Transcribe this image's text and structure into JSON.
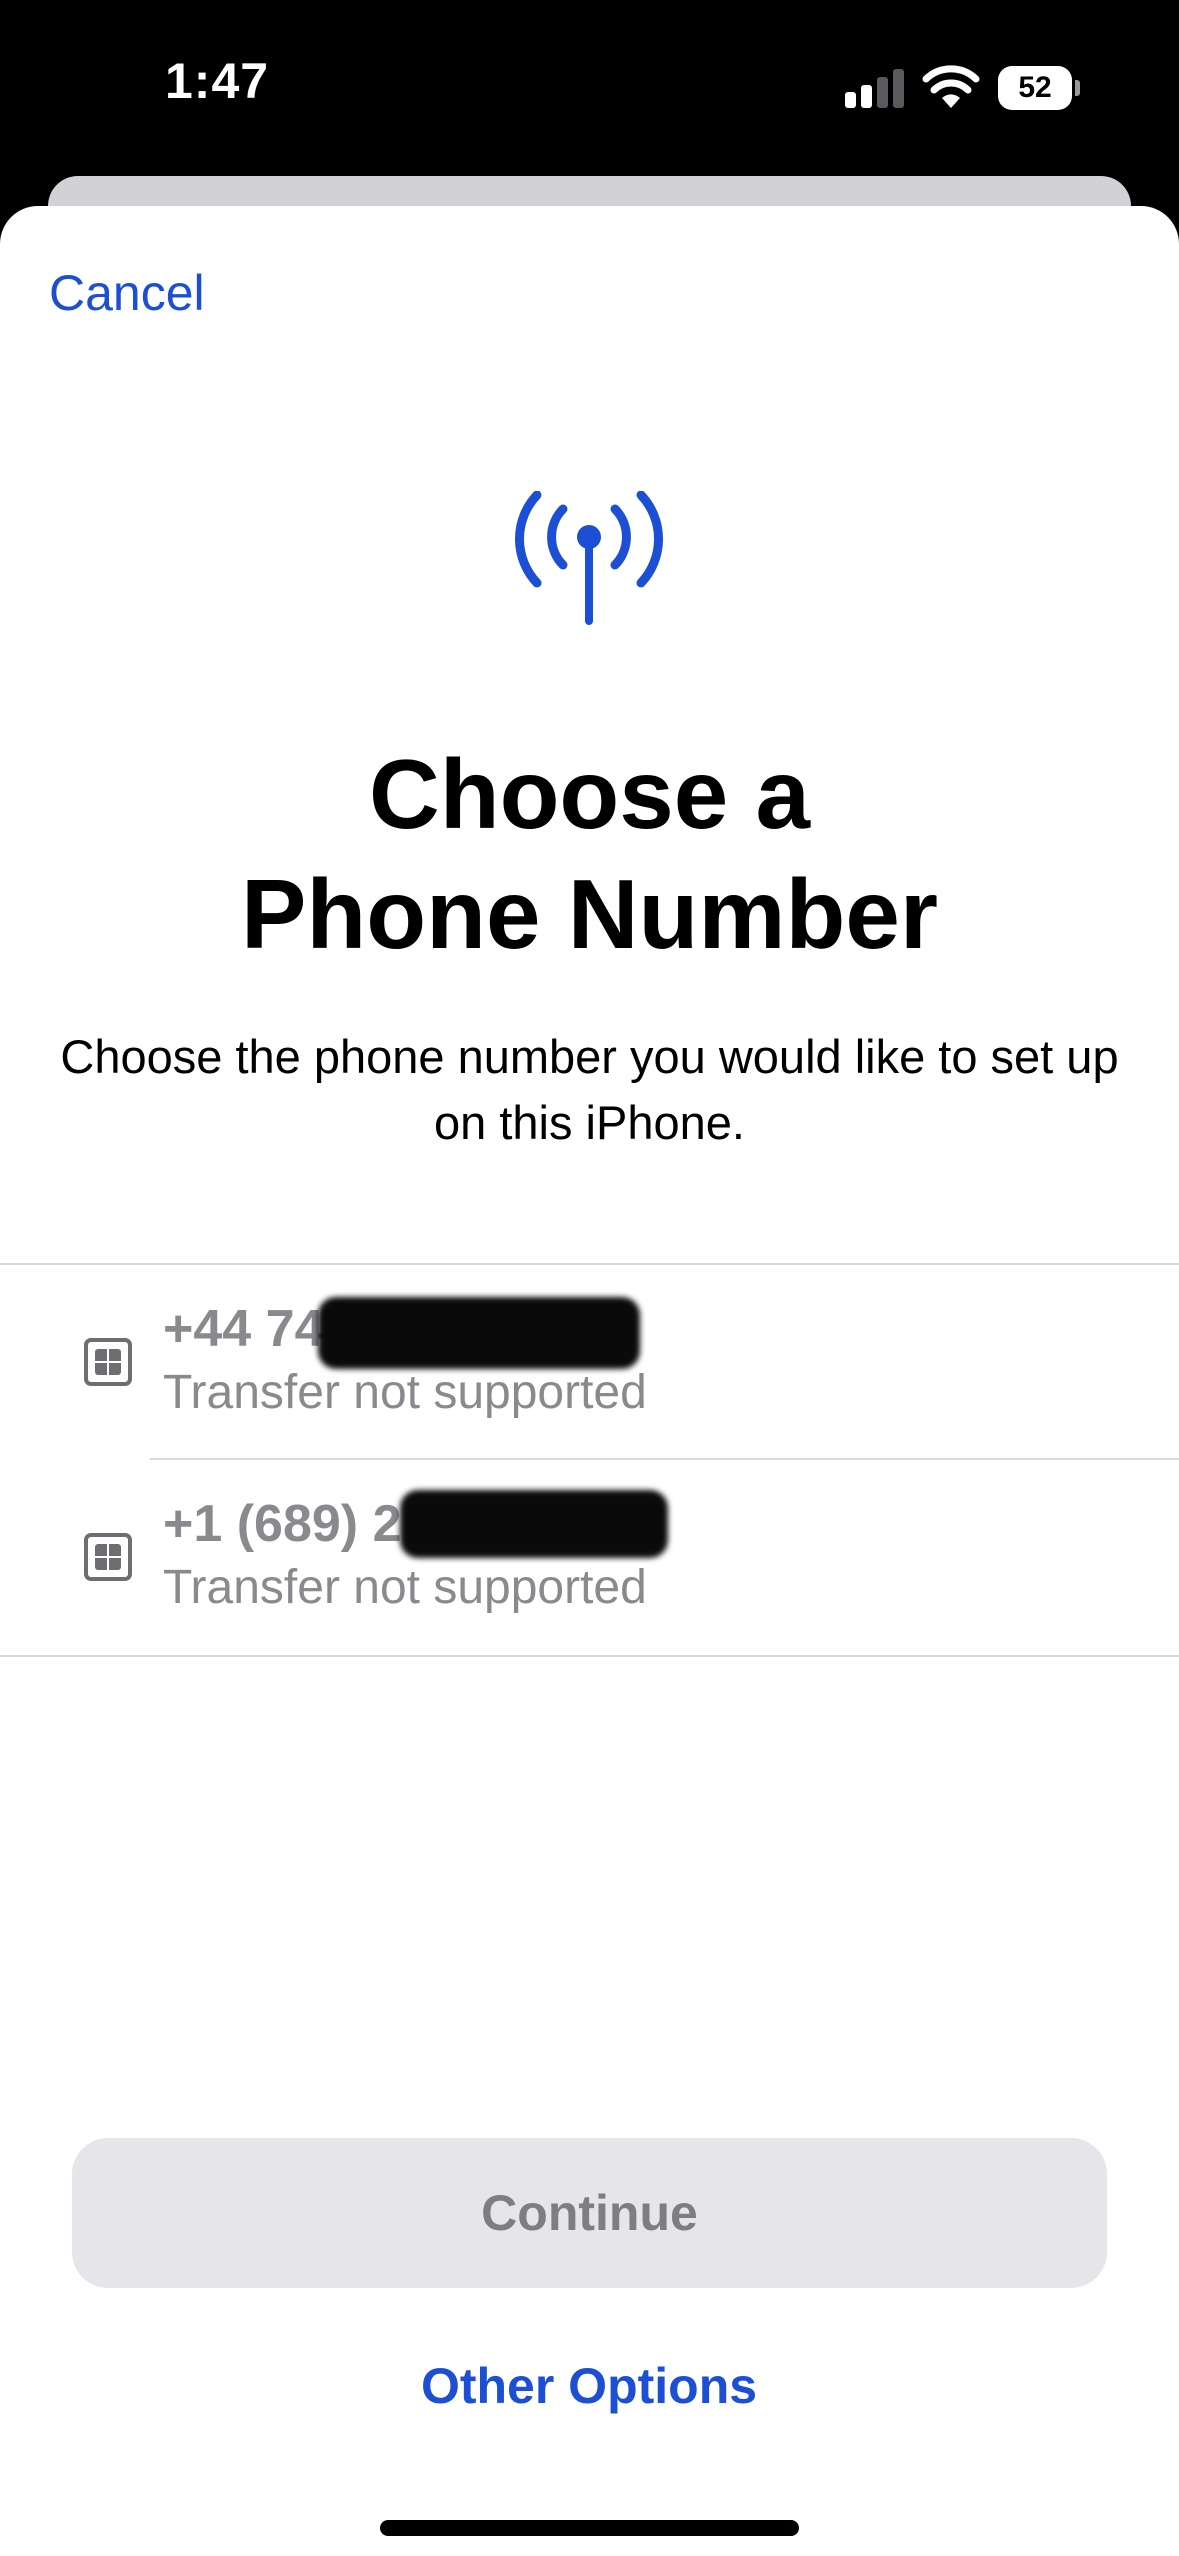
{
  "status_bar": {
    "time": "1:47",
    "battery_level": "52",
    "signal_icon": "cellular-signal-icon",
    "wifi_icon": "wifi-icon"
  },
  "sheet": {
    "cancel_label": "Cancel",
    "header_icon": "antenna-radiowaves-icon",
    "title_line1": "Choose a",
    "title_line2": "Phone Number",
    "subtitle": "Choose the phone number you would like to set up on this iPhone."
  },
  "numbers": [
    {
      "icon": "sim-card-icon",
      "number": "+44 74",
      "status": "Transfer not supported"
    },
    {
      "icon": "sim-card-icon",
      "number": "+1 (689) 2",
      "status": "Transfer not supported"
    }
  ],
  "actions": {
    "continue_label": "Continue",
    "other_options_label": "Other Options"
  },
  "colors": {
    "accent": "#1c4fd4",
    "secondary_text": "#8a8a8e",
    "disabled_button_bg": "#e5e5ea"
  }
}
